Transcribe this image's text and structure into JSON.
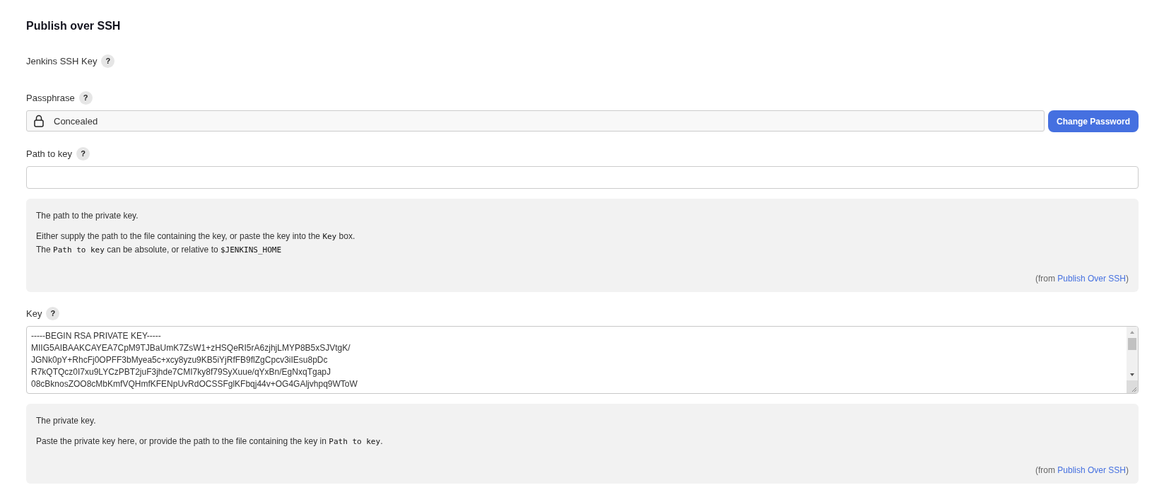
{
  "section_title": "Publish over SSH",
  "fields": [
    {
      "kind": "label",
      "label": "Jenkins SSH Key",
      "help": "?"
    },
    {
      "kind": "secret",
      "label": "Passphrase",
      "help": "?",
      "value": "Concealed",
      "button": "Change Password"
    },
    {
      "kind": "text",
      "label": "Path to key",
      "help": "?",
      "help_box": {
        "paragraphs": [
          [
            [
              {
                "kind": "plain",
                "text": "The path to the private key."
              }
            ]
          ],
          [
            [
              {
                "kind": "plain",
                "text": "Either supply the path to the file containing the key, or paste the key into the "
              },
              {
                "kind": "code",
                "text": "Key"
              },
              {
                "kind": "plain",
                "text": " box."
              }
            ],
            [
              {
                "kind": "plain",
                "text": "The "
              },
              {
                "kind": "code",
                "text": "Path to key"
              },
              {
                "kind": "plain",
                "text": " can be absolute, or relative to "
              },
              {
                "kind": "code",
                "text": "$JENKINS_HOME"
              }
            ]
          ]
        ],
        "from_prefix": "(from ",
        "from_link": "Publish Over SSH",
        "from_suffix": ")"
      }
    },
    {
      "kind": "textarea",
      "label": "Key",
      "help": "?",
      "lines": [
        "-----BEGIN RSA PRIVATE KEY-----",
        "MIIG5AIBAAKCAYEA7CpM9TJBaUmK7ZsW1+zHSQeRI5rA6zjhjLMYP8B5xSJVtgK/",
        "JGNk0pY+RhcFj0OPFF3bMyea5c+xcy8yzu9KB5iYjRfFB9flZgCpcv3iIEsu8pDc",
        "R7kQTQcz0I7xu9LYCzPBT2juF3jhde7CMI7ky8f79SyXuue/qYxBn/EgNxqTgapJ",
        "08cBknosZOO8cMbKmfVQHmfKFENpUvRdOCSSFglKFbqj44v+OG4GAljvhpq9WToW"
      ],
      "help_box": {
        "paragraphs": [
          [
            [
              {
                "kind": "plain",
                "text": "The private key."
              }
            ]
          ],
          [
            [
              {
                "kind": "plain",
                "text": "Paste the private key here, or provide the path to the file containing the key in "
              },
              {
                "kind": "code",
                "text": "Path to key"
              },
              {
                "kind": "plain",
                "text": "."
              }
            ]
          ]
        ],
        "from_prefix": "(from ",
        "from_link": "Publish Over SSH",
        "from_suffix": ")"
      }
    }
  ]
}
